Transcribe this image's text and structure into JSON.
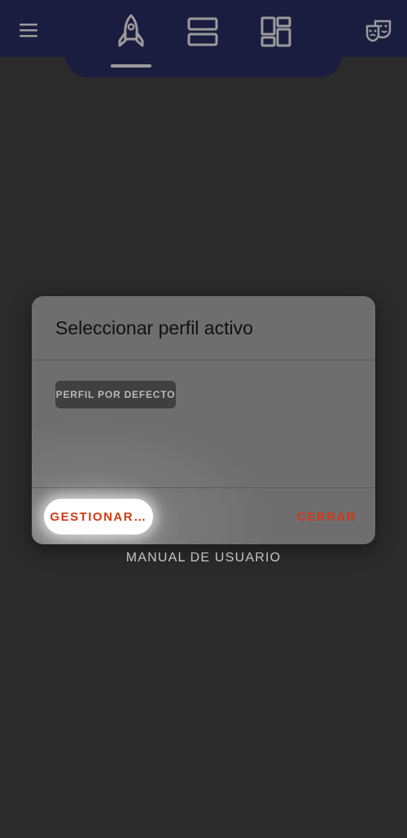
{
  "topbar": {
    "icons": [
      "menu-icon",
      "rocket-icon",
      "rows-icon",
      "grid-icon",
      "masks-icon"
    ],
    "active_tab": "rocket-icon",
    "colors": {
      "background": "#1a1d3f",
      "icon": "#9b9b9b"
    }
  },
  "background": {
    "manual_link": "MANUAL DE USUARIO"
  },
  "dialog": {
    "title": "Seleccionar perfil activo",
    "profiles": [
      {
        "label": "PERFIL POR DEFECTO"
      }
    ],
    "buttons": {
      "manage": "GESTIONAR…",
      "close": "CERRAR"
    },
    "colors": {
      "accent": "#d03a14",
      "surface": "#6e6e6e"
    }
  }
}
